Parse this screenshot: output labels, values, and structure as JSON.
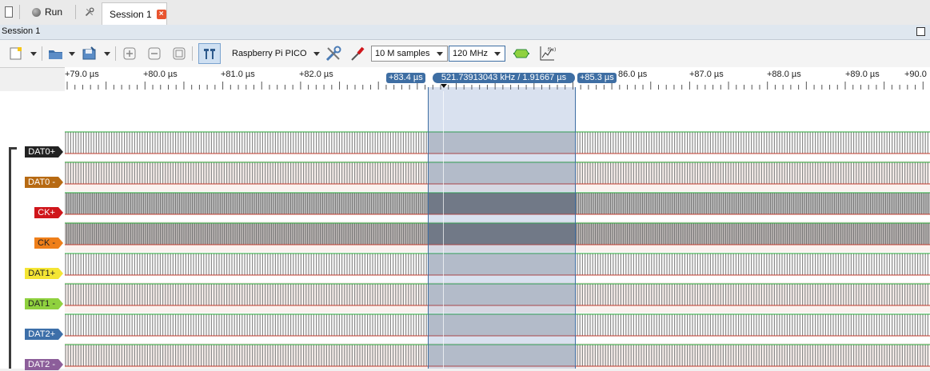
{
  "tabbar": {
    "run_label": "Run",
    "session_tab_label": "Session 1"
  },
  "session": {
    "title": "Session 1"
  },
  "toolbar": {
    "device_label": "Raspberry Pi PICO",
    "samples_value": "10 M samples",
    "rate_value": "120 MHz"
  },
  "ruler": {
    "ticks": [
      "+79.0 µs",
      "+80.0 µs",
      "+81.0 µs",
      "+82.0 µs",
      "86.0 µs",
      "+87.0 µs",
      "+88.0 µs",
      "+89.0 µs",
      "+90.0"
    ],
    "cursor_a": "+83.4 µs",
    "cursor_b": "+85.3 µs",
    "measurement": "521.73913043 kHz / 1.91667 µs"
  },
  "channels": [
    {
      "name": "DAT0+",
      "color": "#222222",
      "text": "#ffffff"
    },
    {
      "name": "DAT0 -",
      "color": "#b76a13",
      "text": "#ffffff"
    },
    {
      "name": "CK+",
      "color": "#d0161b",
      "text": "#ffffff"
    },
    {
      "name": "CK -",
      "color": "#ef7f1a",
      "text": "#222222"
    },
    {
      "name": "DAT1+",
      "color": "#f4e534",
      "text": "#222222"
    },
    {
      "name": "DAT1 -",
      "color": "#8fd13f",
      "text": "#222222"
    },
    {
      "name": "DAT2+",
      "color": "#3d6fa9",
      "text": "#ffffff"
    },
    {
      "name": "DAT2 -",
      "color": "#8c5e9a",
      "text": "#ffffff"
    }
  ]
}
